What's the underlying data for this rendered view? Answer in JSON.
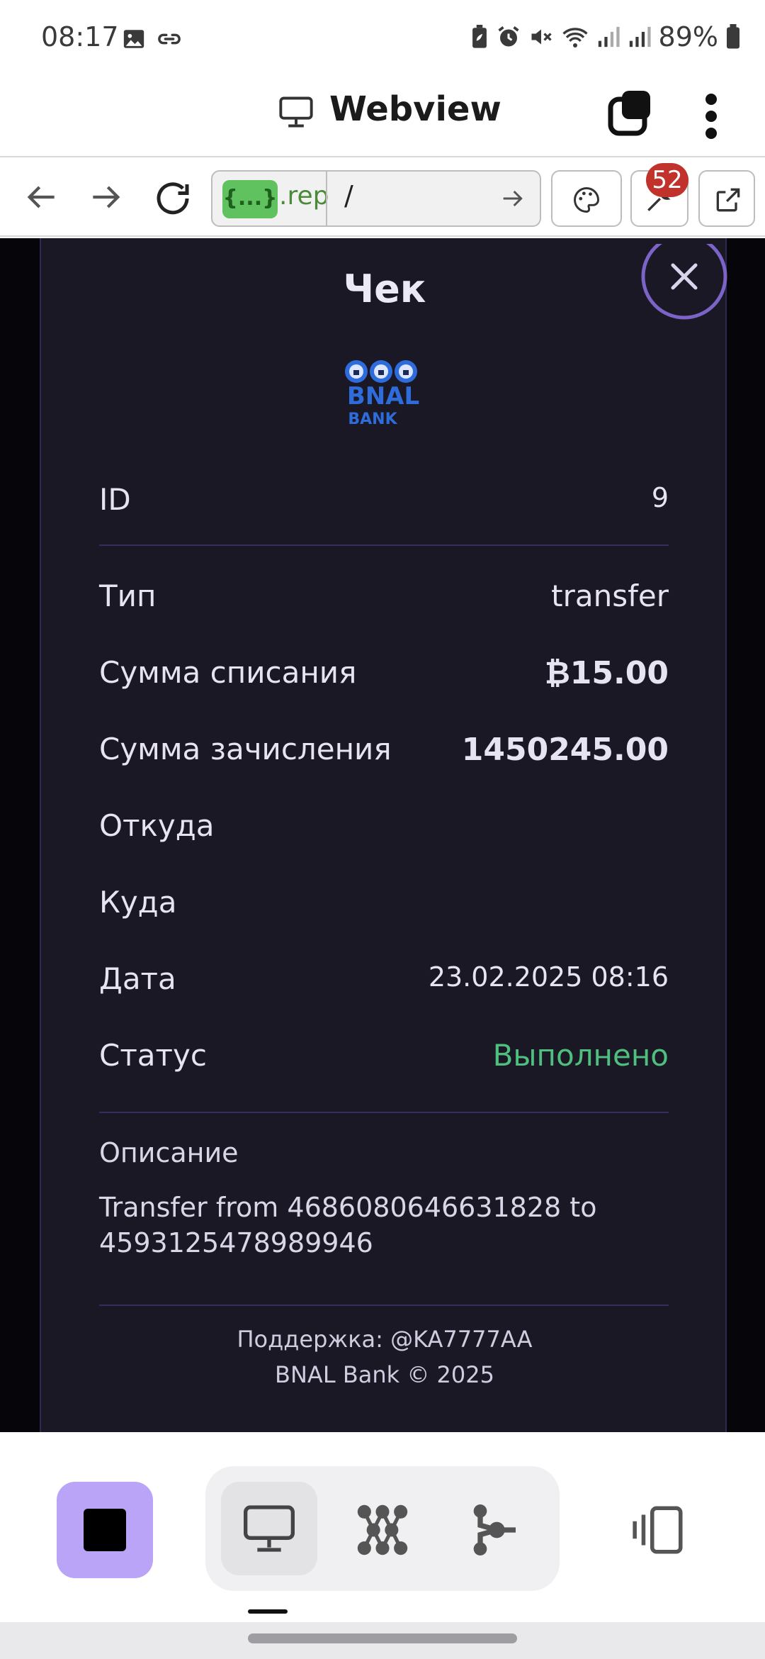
{
  "status_bar": {
    "time": "08:17",
    "battery": "89%"
  },
  "app_bar": {
    "title": "Webview"
  },
  "toolbar": {
    "url_badge": "{...}",
    "url_domain": ".rep",
    "url_path": "/",
    "badge_count": "52"
  },
  "receipt": {
    "title": "Чек",
    "logo_text": "BNAL",
    "logo_sub": "BANK",
    "rows": [
      {
        "label": "ID",
        "value": "9"
      },
      {
        "label": "Тип",
        "value": "transfer"
      },
      {
        "label": "Сумма списания",
        "value": "₿15.00"
      },
      {
        "label": "Сумма зачисления",
        "value": "1450245.00"
      },
      {
        "label": "Откуда",
        "value": ""
      },
      {
        "label": "Куда",
        "value": ""
      },
      {
        "label": "Дата",
        "value": "23.02.2025 08:16"
      },
      {
        "label": "Статус",
        "value": "Выполнено"
      }
    ],
    "description_title": "Описание",
    "description_text": "Transfer from 4686080646631828 to 4593125478989946",
    "support": "Поддержка: @KA7777AA",
    "copyright": "BNAL Bank © 2025"
  },
  "colors": {
    "panel_bg": "#191824",
    "status_success": "#4fbf7f",
    "accent": "#b9a4f8"
  }
}
